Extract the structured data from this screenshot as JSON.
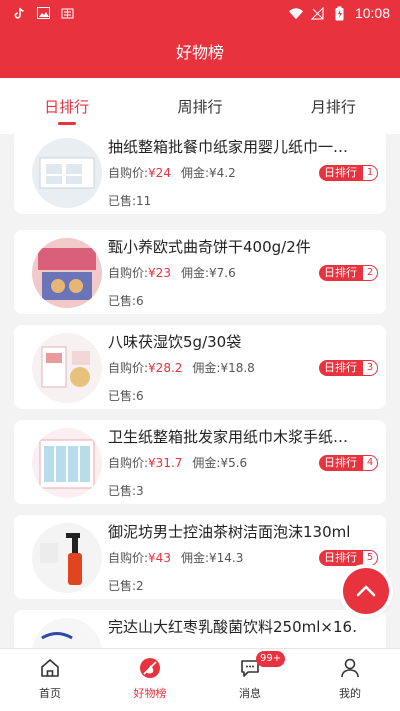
{
  "statusbar": {
    "time": "10:08"
  },
  "header": {
    "title": "好物榜"
  },
  "tabs": [
    {
      "label": "日排行"
    },
    {
      "label": "周排行"
    },
    {
      "label": "月排行"
    }
  ],
  "labels": {
    "self_buy": "自购价:",
    "commission": "佣金:",
    "sold": "已售:"
  },
  "products": [
    {
      "title": "抽纸整箱批餐巾纸家用婴儿纸巾一…",
      "price": "¥24",
      "commission": "¥4.2",
      "sold": "11",
      "rank_label": "日排行",
      "rank": "1"
    },
    {
      "title": "甄小养欧式曲奇饼干400g/2件",
      "price": "¥23",
      "commission": "¥7.6",
      "sold": "6",
      "rank_label": "日排行",
      "rank": "2"
    },
    {
      "title": "八味茯湿饮5g/30袋",
      "price": "¥28.2",
      "commission": "¥18.8",
      "sold": "6",
      "rank_label": "日排行",
      "rank": "3"
    },
    {
      "title": "卫生纸整箱批发家用纸巾木浆手纸…",
      "price": "¥31.7",
      "commission": "¥5.6",
      "sold": "3",
      "rank_label": "日排行",
      "rank": "4"
    },
    {
      "title": "御泥坊男士控油茶树洁面泡沫130ml",
      "price": "¥43",
      "commission": "¥14.3",
      "sold": "2",
      "rank_label": "日排行",
      "rank": "5"
    },
    {
      "title": "完达山大红枣乳酸菌饮料250ml×16…",
      "price": "",
      "commission": "",
      "sold": "",
      "rank_label": "",
      "rank": ""
    }
  ],
  "bottom_nav": [
    {
      "label": "首页",
      "icon": "home-icon"
    },
    {
      "label": "好物榜",
      "icon": "hot-icon"
    },
    {
      "label": "消息",
      "icon": "message-icon",
      "badge": "99+"
    },
    {
      "label": "我的",
      "icon": "user-icon"
    }
  ],
  "colors": {
    "accent": "#e8333f",
    "background": "#f3f3f3"
  }
}
